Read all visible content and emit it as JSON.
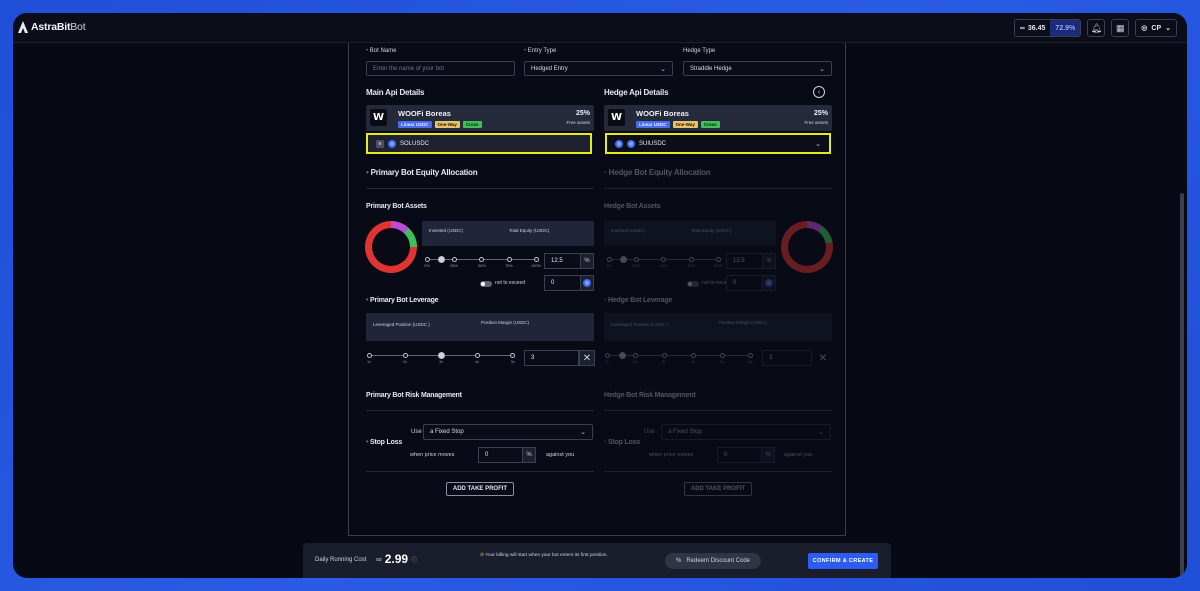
{
  "app": {
    "brand_main": "AstraBit",
    "brand_sub": "Bot"
  },
  "topbar": {
    "credits_value": "36.45",
    "credits_highlight": "72.9%",
    "user_initials": "CP",
    "icons": [
      "link-icon",
      "bell-icon",
      "grid-icon",
      "user-icon",
      "chevron-down-icon"
    ]
  },
  "form": {
    "bot_name_label": "Bot Name",
    "bot_name_placeholder": "Enter the name of your bot",
    "entry_type_label": "Entry Type",
    "entry_type_value": "Hedged Entry",
    "hedge_type_label": "Hedge Type",
    "hedge_type_value": "Straddle Hedge"
  },
  "main": {
    "api_title": "Main Api Details",
    "exchange_name": "WOOFi Boreas",
    "tags": [
      "Linear USDC",
      "One-Way",
      "Cross"
    ],
    "pct": "25%",
    "free_assets": "Free assets",
    "pair": "SOLUSDC",
    "equity_title": "Primary Bot Equity Allocation",
    "assets_title": "Primary Bot Assets",
    "invested_label": "Invested (USDC)",
    "total_equity_label": "Total Equity (USDC)",
    "alloc_ticks": [
      "0%",
      "25%",
      "50%",
      "75%",
      "100%"
    ],
    "alloc_value": "12.5",
    "alloc_unit": "%",
    "not_exceed_label": "not to exceed",
    "not_exceed_value": "0",
    "leverage_title": "Primary Bot Leverage",
    "lev_position_label": "Leveraged Position (USDC )",
    "pos_margin_label": "Position Margin (USDC)",
    "lev_ticks": [
      "1x",
      "2x",
      "3x",
      "4x",
      "5x"
    ],
    "lev_value": "3",
    "risk_title": "Primary Bot Risk Management",
    "stop_loss_label": "Stop Loss",
    "use_label": "Use",
    "use_value": "a Fixed Stop",
    "when_moves": "when price moves",
    "sl_value": "0",
    "sl_unit": "%",
    "against_you": "against you",
    "add_tp": "ADD TAKE PROFIT"
  },
  "hedge": {
    "api_title": "Hedge Api Details",
    "exchange_name": "WOOFi Boreas",
    "tags": [
      "Linear USDC",
      "One-Way",
      "Cross"
    ],
    "pct": "25%",
    "free_assets": "Free assets",
    "pair": "SUIUSDC",
    "equity_title": "Hedge Bot Equity Allocation",
    "assets_title": "Hedge Bot Assets",
    "invested_label": "Invested (USDC)",
    "total_equity_label": "Total Equity (USDC)",
    "alloc_ticks": [
      "0%",
      "25%",
      "50%",
      "75%",
      "100%"
    ],
    "alloc_value": "12.5",
    "alloc_unit": "%",
    "not_exceed_label": "not to exceed",
    "not_exceed_value": "0",
    "leverage_title": "Hedge Bot Leverage",
    "lev_position_label": "Leveraged Position (USDC )",
    "pos_margin_label": "Position Margin (USDC)",
    "lev_ticks": [
      "1x",
      "2x",
      "3x",
      "4x",
      "5x",
      "10x"
    ],
    "lev_value": "3",
    "risk_title": "Hedge Bot Risk Management",
    "stop_loss_label": "Stop Loss",
    "use_label": "Use",
    "use_value": "a Fixed Stop",
    "when_moves": "when price moves",
    "sl_value": "0",
    "sl_unit": "%",
    "against_you": "against you",
    "add_tp": "ADD TAKE PROFIT"
  },
  "footer": {
    "daily_cost_label": "Daily Running Cost",
    "daily_cost_value": "2.99",
    "billing_note": "Your billing will start when your bot enters its first position.",
    "redeem": "Redeem Discount Code",
    "confirm": "CONFIRM & CREATE"
  },
  "colors": {
    "accent": "#2d5df0",
    "highlight_border": "#e8ea1e",
    "ring_red": "#e03434",
    "ring_green": "#3fbf5a",
    "ring_pink": "#c04ad8"
  }
}
